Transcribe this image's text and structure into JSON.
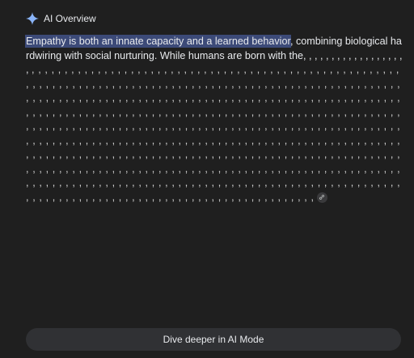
{
  "header": {
    "title": "AI Overview",
    "icon": "sparkle-icon"
  },
  "answer": {
    "highlighted": "Empathy is both an innate capacity and a learned behavior",
    "rest": ", combining biological hardwiring with social nurturing. While humans are born with the, , , , , , , , , , , , , , , , , , ,",
    "filler": ", , , , , , , , , , , , , , , , , , , , , , , , , , , , , , , , , , , , , , , , , , , , , , , , , , , , , , , , , , , , , , , , , , , , , , , , , , , , , , , , , , , , , , , , , , , , , , , , , , , , , , , , , , , , , , , , , , , , , , , , , , , , , , , , , , , , , , , , , , , , , , , , , , , , , , , , , , , , , , , , , , , , , , , , , , , , , , , , , , , , , , , , , , , , , , , , , , , , , , , , , , , , , , , , , , , , , , , , , , , , , , , , , , , , , , , , , , , , , , , , , , , , , , , , , , , , , , , , , , , , , , , , , , , , , , , , , , , , , , , , , , , , , , , , , , , , , , , , , , , , , , , , , , , , , , , , , , , , , , , , , , , , , , , , , , , , , , , , , , , , , , , , , , , , , , , , , , , , , , , , , , , , , , , , , , , , , , , , , , , , , , , , , , , , , , , , , , , , , , , , , , , , , , , , , , , , , , , , , , , , , , , , , , , , , , , , , , , , , , , , , , , , , , , , , , , , , , , , , , , , , , , , , , , , , , , , , , , , , , , , , , , , , , , , , , , , , , , , , , , , , , , , , , , , , , , , , , , , , , , , , , , , , , , , , , , , , , , , , , , , , , , , , , , , , , , , , , , ,",
    "citation_icon": "link-icon"
  },
  "footer": {
    "button_label": "Dive deeper in AI Mode"
  },
  "colors": {
    "background": "#1f1f1f",
    "highlight": "#3c4a78",
    "button": "#303134",
    "sparkle": "#8ab4f8"
  }
}
